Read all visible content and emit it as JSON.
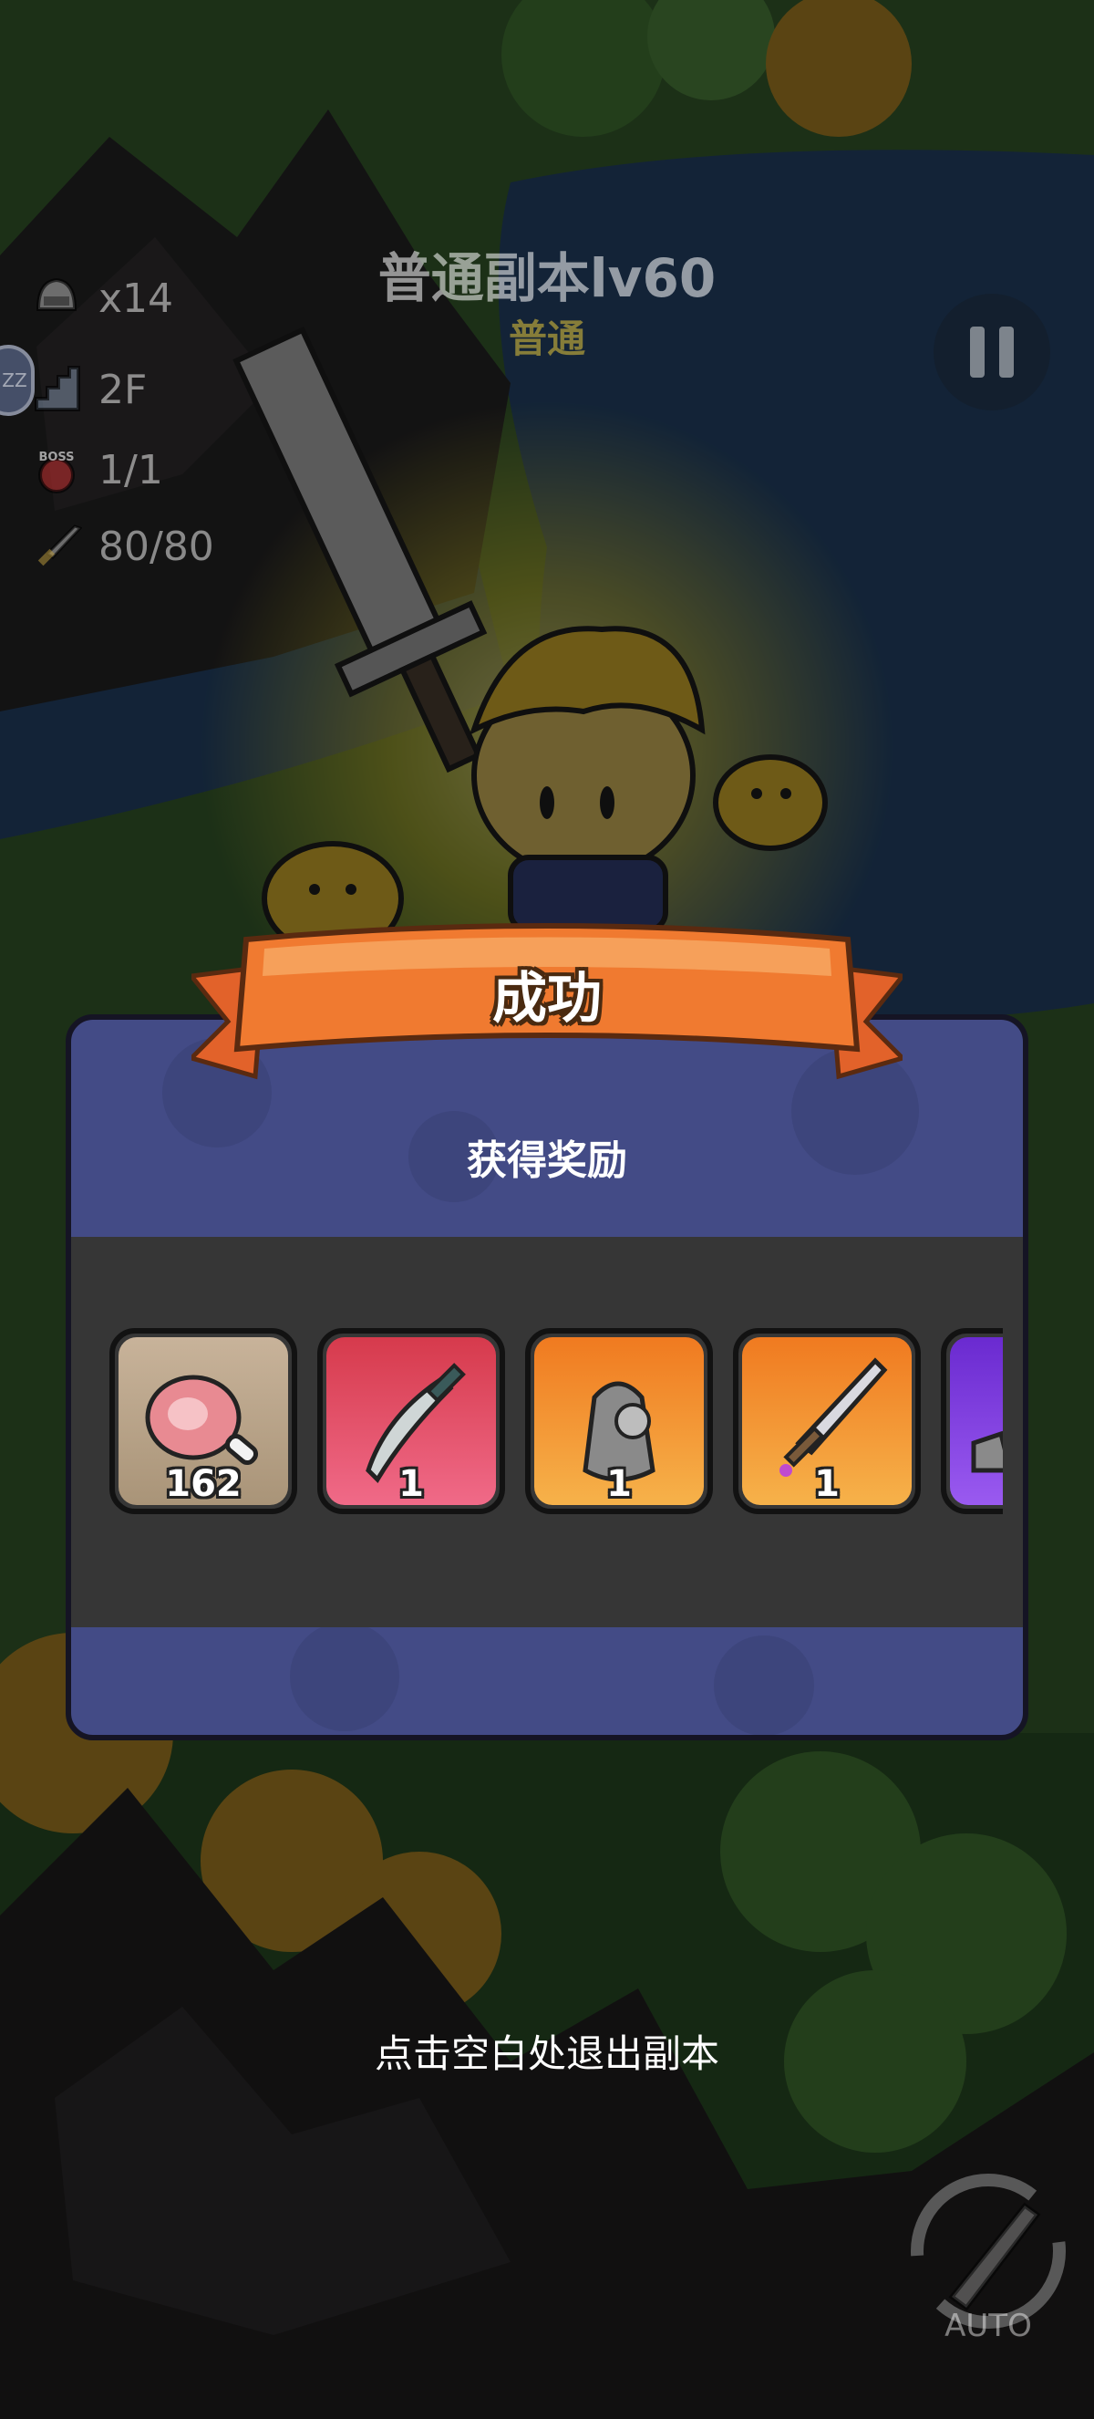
{
  "dungeon": {
    "title": "普通副本lv60",
    "difficulty": "普通"
  },
  "hud": {
    "stats": [
      {
        "icon": "helmet-icon",
        "value": "x14"
      },
      {
        "icon": "stairs-icon",
        "value": "2F"
      },
      {
        "icon": "boss-icon",
        "value": "1/1",
        "icon_text": "BOSS"
      },
      {
        "icon": "sword-icon",
        "value": "80/80"
      }
    ],
    "sleep_badge": "ZZ"
  },
  "result": {
    "banner": "成功",
    "reward_title": "获得奖励",
    "rewards": [
      {
        "icon": "meat-icon",
        "count": "162",
        "rarity": "common",
        "bg": "#b9a48a"
      },
      {
        "icon": "dagger-icon",
        "count": "1",
        "rarity": "red",
        "bg": "#e0405a"
      },
      {
        "icon": "armor-icon",
        "count": "1",
        "rarity": "orange",
        "bg": "#f08a2a"
      },
      {
        "icon": "sword-icon",
        "count": "1",
        "rarity": "orange",
        "bg": "#f08a2a"
      },
      {
        "icon": "boots-icon",
        "count": "",
        "rarity": "purple",
        "bg": "#7a3ae0"
      }
    ],
    "exit_hint": "点击空白处退出副本"
  },
  "controls": {
    "auto_label": "AUTO"
  },
  "colors": {
    "panel": "#434b86",
    "strip": "#363636",
    "ribbon": "#f07a30",
    "highlight": "#f4e23a"
  }
}
